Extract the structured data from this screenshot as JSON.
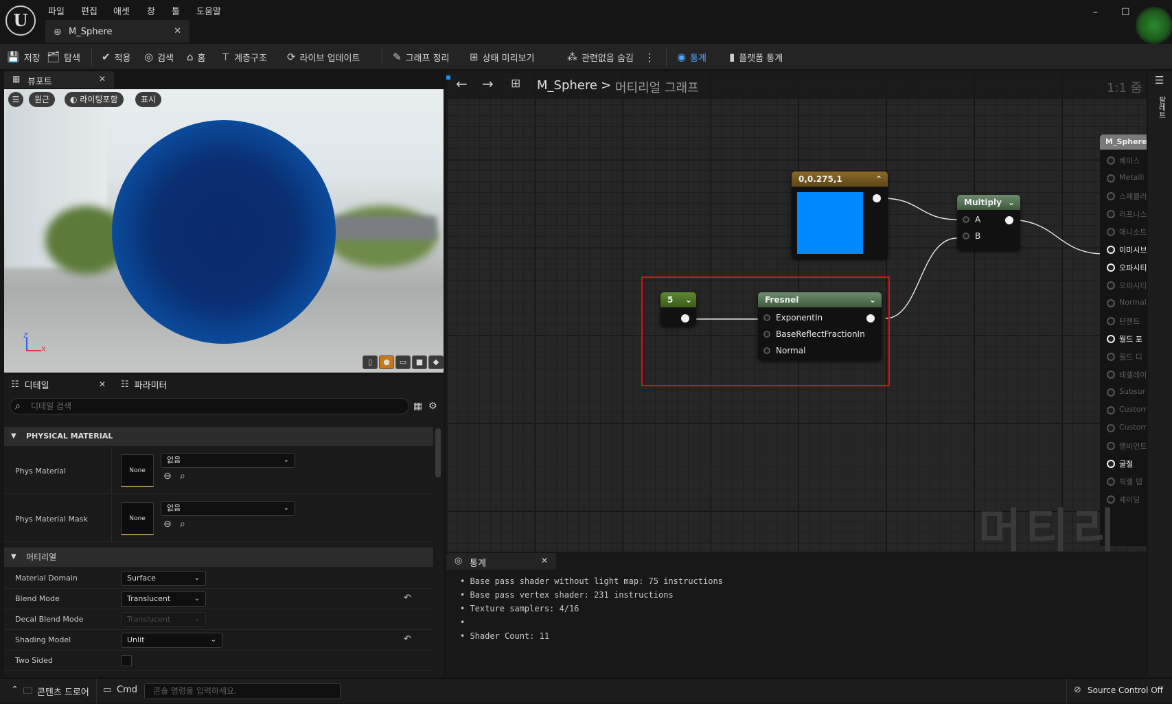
{
  "app": {
    "logo": "U",
    "tab_title": "M_Sphere"
  },
  "menu": [
    "파일",
    "편집",
    "애셋",
    "창",
    "툴",
    "도움말"
  ],
  "window_controls": {
    "minimize": "–",
    "maximize": "☐",
    "close": "✕"
  },
  "toolbar": {
    "save": "저장",
    "browse": "탐색",
    "apply": "적용",
    "search": "검색",
    "home": "홈",
    "hierarchy": "계층구조",
    "live_update": "라이브 업데이트",
    "clean_graph": "그래프 정리",
    "state_preview": "상태 미리보기",
    "hide_unrelated": "관련없음 숨김",
    "stats": "통계",
    "platform_stats": "플랫폼 통계"
  },
  "viewport": {
    "tab": "뷰포트",
    "pills": [
      "원근",
      "라이팅포함",
      "표시"
    ],
    "axis_z": "Z",
    "axis_x": "X",
    "preview_shapes": [
      "cylinder-icon",
      "sphere-icon",
      "plane-icon",
      "cube-icon",
      "mesh-icon"
    ]
  },
  "details": {
    "tab_details": "디테일",
    "tab_params": "파라미터",
    "search_placeholder": "디테일 검색",
    "section_physical": "PHYSICAL MATERIAL",
    "phys_material": {
      "label": "Phys Material",
      "thumb": "None",
      "value": "없음"
    },
    "phys_material_mask": {
      "label": "Phys Material Mask",
      "thumb": "None",
      "value": "없음"
    },
    "section_material": "머티리얼",
    "rows": [
      {
        "label": "Material Domain",
        "value": "Surface"
      },
      {
        "label": "Blend Mode",
        "value": "Translucent"
      },
      {
        "label": "Decal Blend Mode",
        "value": "Translucent"
      },
      {
        "label": "Shading Model",
        "value": "Unlit"
      },
      {
        "label": "Two Sided",
        "value": ""
      }
    ]
  },
  "graph": {
    "nav_back": "←",
    "nav_fwd": "→",
    "breadcrumb_asset": "M_Sphere",
    "breadcrumb_sep": ">",
    "breadcrumb_graph": "머티리얼 그래프",
    "zoom": "1:1 줌",
    "color_node": {
      "title": "0,0.275,1",
      "color": "#0088ff"
    },
    "multiply_node": {
      "title": "Multiply",
      "pin_a": "A",
      "pin_b": "B"
    },
    "const_node": {
      "title": "5"
    },
    "fresnel_node": {
      "title": "Fresnel",
      "pins": [
        "ExponentIn",
        "BaseReflectFractionIn",
        "Normal"
      ]
    },
    "output_node": {
      "title": "M_Sphere",
      "pins": [
        {
          "label": "베이스",
          "active": false
        },
        {
          "label": "Metalli",
          "active": false
        },
        {
          "label": "스페큘러",
          "active": false
        },
        {
          "label": "러프니스",
          "active": false
        },
        {
          "label": "애니소트",
          "active": false
        },
        {
          "label": "이미시브",
          "active": true
        },
        {
          "label": "오파시티",
          "active": true
        },
        {
          "label": "오파시티",
          "active": false
        },
        {
          "label": "Normal",
          "active": false
        },
        {
          "label": "탄젠트",
          "active": false
        },
        {
          "label": "월드 포",
          "active": true
        },
        {
          "label": "월드 디",
          "active": false
        },
        {
          "label": "테셀레이",
          "active": false
        },
        {
          "label": "Subsur",
          "active": false
        },
        {
          "label": "Custom",
          "active": false
        },
        {
          "label": "Custom",
          "active": false
        },
        {
          "label": "앰비언트",
          "active": false
        },
        {
          "label": "굴절",
          "active": true
        },
        {
          "label": "픽셀 뎁",
          "active": false
        },
        {
          "label": "셰이딩 ",
          "active": false
        }
      ]
    },
    "watermark": "머티리얼"
  },
  "stats": {
    "tab": "통계",
    "lines": [
      "Base pass shader without light map: 75 instructions",
      "Base pass vertex shader: 231 instructions",
      "Texture samplers: 4/16",
      "",
      "Shader Count: 11"
    ]
  },
  "right_strip": {
    "palette": "팔레트"
  },
  "statusbar": {
    "content_drawer": "콘텐츠 드로어",
    "cmd": "Cmd",
    "console_placeholder": "콘솔 명령을 입력하세요.",
    "source_control": "Source Control Off"
  }
}
